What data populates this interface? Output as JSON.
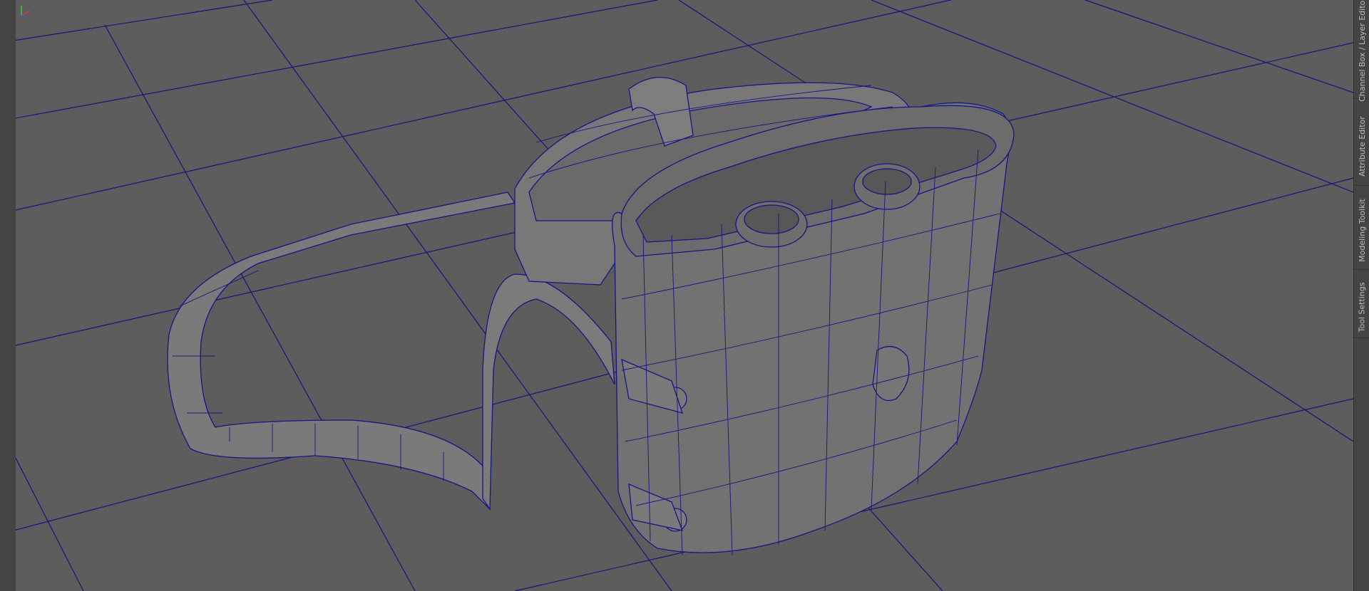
{
  "side_tabs": [
    {
      "label": "Channel Box / Layer Editor"
    },
    {
      "label": "Attribute Editor"
    },
    {
      "label": "Modeling Toolkit"
    },
    {
      "label": "Tool Settings"
    }
  ],
  "viewport": {
    "background": "#5d5d5d",
    "grid_color": "#14147a",
    "wire_color": "#151585",
    "object": "binocular-case-mesh"
  },
  "axis_gizmo": {
    "x_color": "#d43a3a",
    "y_color": "#49c24a",
    "z_color": "#3a5bd4"
  }
}
